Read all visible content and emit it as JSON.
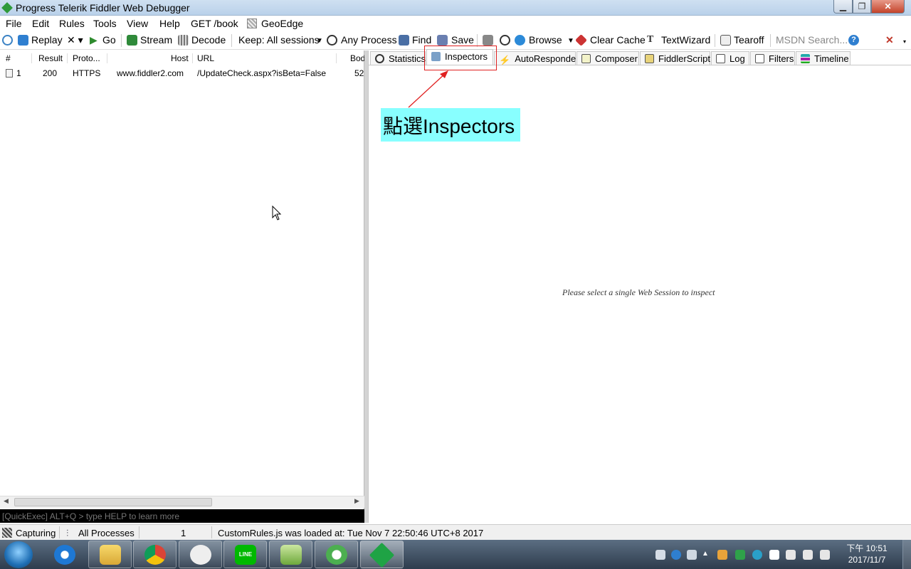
{
  "window": {
    "title": "Progress Telerik Fiddler Web Debugger"
  },
  "menu": [
    "File",
    "Edit",
    "Rules",
    "Tools",
    "View",
    "Help",
    "GET /book",
    "GeoEdge"
  ],
  "toolbar": {
    "replay": "Replay",
    "remove": "✕ ▾",
    "go": "Go",
    "stream": "Stream",
    "decode": "Decode",
    "keep": "Keep: All sessions",
    "any_process": "Any Process",
    "find": "Find",
    "save": "Save",
    "browse": "Browse",
    "clear_cache": "Clear Cache",
    "text_wizard": "TextWizard",
    "tearoff": "Tearoff",
    "msdn_search": "MSDN Search...",
    "close": "✕"
  },
  "sessions": {
    "columns": [
      "#",
      "Result",
      "Proto...",
      "Host",
      "URL",
      "Bod"
    ],
    "rows": [
      {
        "num": "1",
        "result": "200",
        "protocol": "HTTPS",
        "host": "www.fiddler2.com",
        "url": "/UpdateCheck.aspx?isBeta=False",
        "body": "52"
      }
    ]
  },
  "quickexec": {
    "placeholder": "[QuickExec] ALT+Q > type HELP to learn more"
  },
  "tabs": [
    "Statistics",
    "Inspectors",
    "AutoResponder",
    "Composer",
    "FiddlerScript",
    "Log",
    "Filters",
    "Timeline"
  ],
  "active_tab": "Inspectors",
  "annotation": {
    "text": "點選Inspectors"
  },
  "empty_message": "Please select a single Web Session to inspect",
  "status": {
    "capturing": "Capturing",
    "processes": "All Processes",
    "count": "1",
    "message": "CustomRules.js was loaded at: Tue Nov 7 22:50:46 UTC+8 2017"
  },
  "clock": {
    "time": "下午 10:51",
    "date": "2017/11/7"
  },
  "colors": {
    "annotation_bg": "#88ffff",
    "highlight": "#e02020",
    "taskbar": "#3b4b5d"
  }
}
